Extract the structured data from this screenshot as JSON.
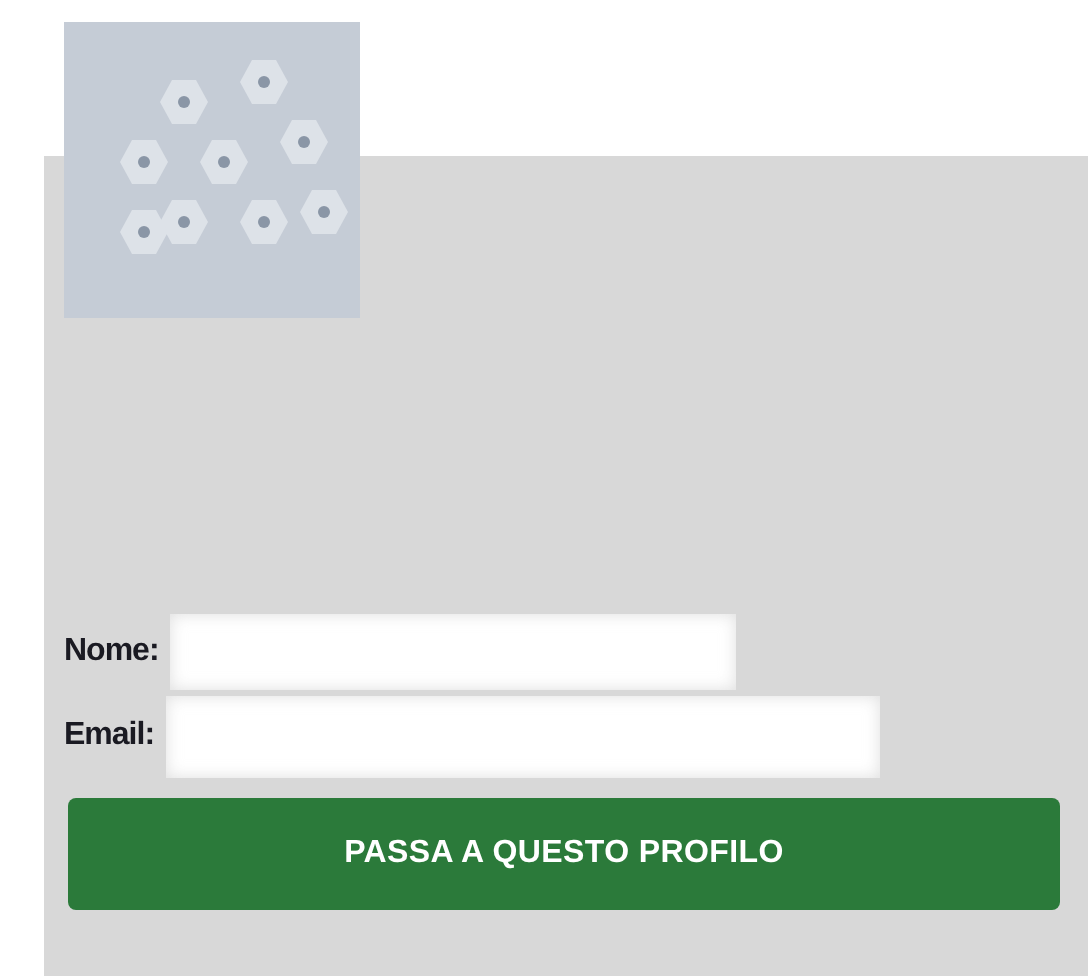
{
  "profile": {
    "fields": [
      {
        "label": "Nome:"
      },
      {
        "label": "Email:"
      }
    ],
    "button": {
      "label": "PASSA A QUESTO PROFILO"
    }
  }
}
